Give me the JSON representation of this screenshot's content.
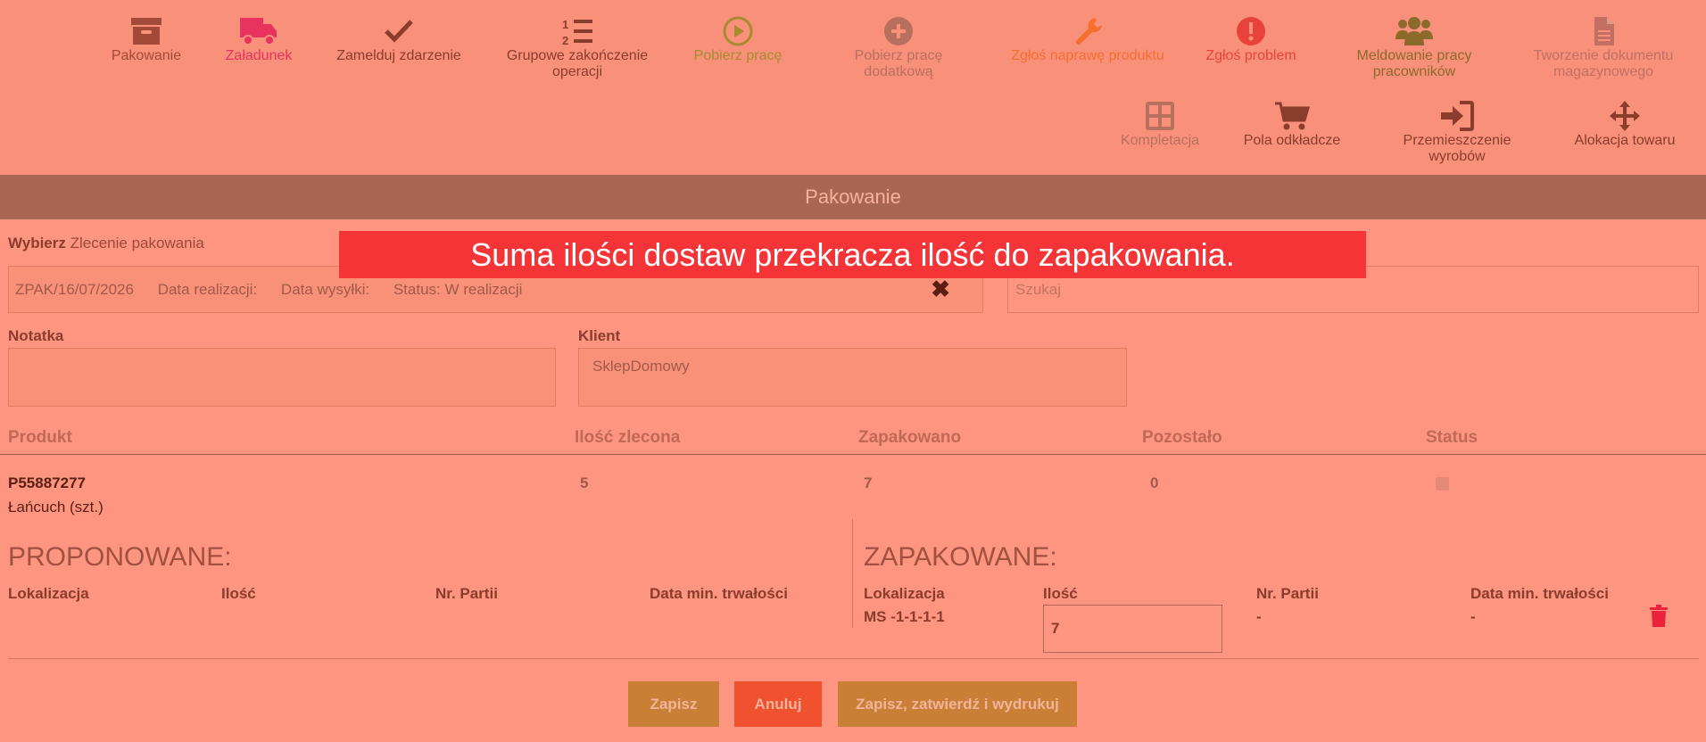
{
  "toolbar": {
    "items": [
      {
        "label": "Pakowanie",
        "icon": "archive-icon",
        "color": "#a24a37"
      },
      {
        "label": "Załadunek",
        "icon": "truck-icon",
        "color": "#e8335f"
      },
      {
        "label": "Zamelduj zdarzenie",
        "icon": "check-icon",
        "color": "#8a3d2b"
      },
      {
        "label": "Grupowe zakończenie operacji",
        "icon": "numbered-list-icon",
        "color": "#8a3d2b"
      },
      {
        "label": "Pobierz pracę",
        "icon": "play-circle-icon",
        "color": "#a68c2f"
      },
      {
        "label": "Pobierz pracę dodatkową",
        "icon": "plus-circle-icon",
        "color": "#b8705e"
      },
      {
        "label": "Zgłoś naprawę produktu",
        "icon": "wrench-icon",
        "color": "#f56f2e"
      },
      {
        "label": "Zgłoś problem",
        "icon": "exclamation-circle-icon",
        "color": "#e8433a"
      },
      {
        "label": "Meldowanie pracy pracowników",
        "icon": "users-icon",
        "color": "#8b6a2c"
      },
      {
        "label": "Tworzenie dokumentu magazynowego",
        "icon": "document-icon",
        "color": "#c27062"
      },
      {
        "label": "Kompletacja",
        "icon": "grid-icon",
        "color": "#b8705e"
      },
      {
        "label": "Pola odkładcze",
        "icon": "cart-icon",
        "color": "#8a3d2b"
      },
      {
        "label": "Przemieszczenie wyrobów",
        "icon": "sign-in-icon",
        "color": "#8a3d2b"
      },
      {
        "label": "Alokacja towaru",
        "icon": "move-arrows-icon",
        "color": "#8a3d2b"
      }
    ]
  },
  "header": {
    "title": "Pakowanie"
  },
  "alert": {
    "message": "Suma ilości dostaw przekracza ilość do zapakowania."
  },
  "form": {
    "select_label_strong": "Wybierz",
    "select_label": "Zlecenie pakowania",
    "order": {
      "number": "ZPAK/16/07/2026",
      "realization": "Data realizacji:",
      "shipping": "Data wysyłki:",
      "status": "Status: W realizacji"
    },
    "search_placeholder": "Szukaj",
    "note_label": "Notatka",
    "client_label": "Klient",
    "client_value": "SklepDomowy"
  },
  "table": {
    "headers": [
      "Produkt",
      "Ilość zlecona",
      "Zapakowano",
      "Pozostało",
      "Status"
    ],
    "row": {
      "code": "P55887277",
      "name": "Łańcuch (szt.)",
      "ordered": "5",
      "packed": "7",
      "remaining": "0"
    }
  },
  "proposed": {
    "title": "PROPONOWANE:",
    "headers": [
      "Lokalizacja",
      "Ilość",
      "Nr. Partii",
      "Data min. trwałości"
    ]
  },
  "packed": {
    "title": "ZAPAKOWANE:",
    "headers": [
      "Lokalizacja",
      "Ilość",
      "Nr. Partii",
      "Data min. trwałości"
    ],
    "row": {
      "location": "MS -1-1-1-1",
      "qty": "7",
      "batch": "-",
      "expiry": "-"
    }
  },
  "buttons": {
    "save": "Zapisz",
    "cancel": "Anuluj",
    "save_print": "Zapisz, zatwierdź i wydrukuj"
  }
}
